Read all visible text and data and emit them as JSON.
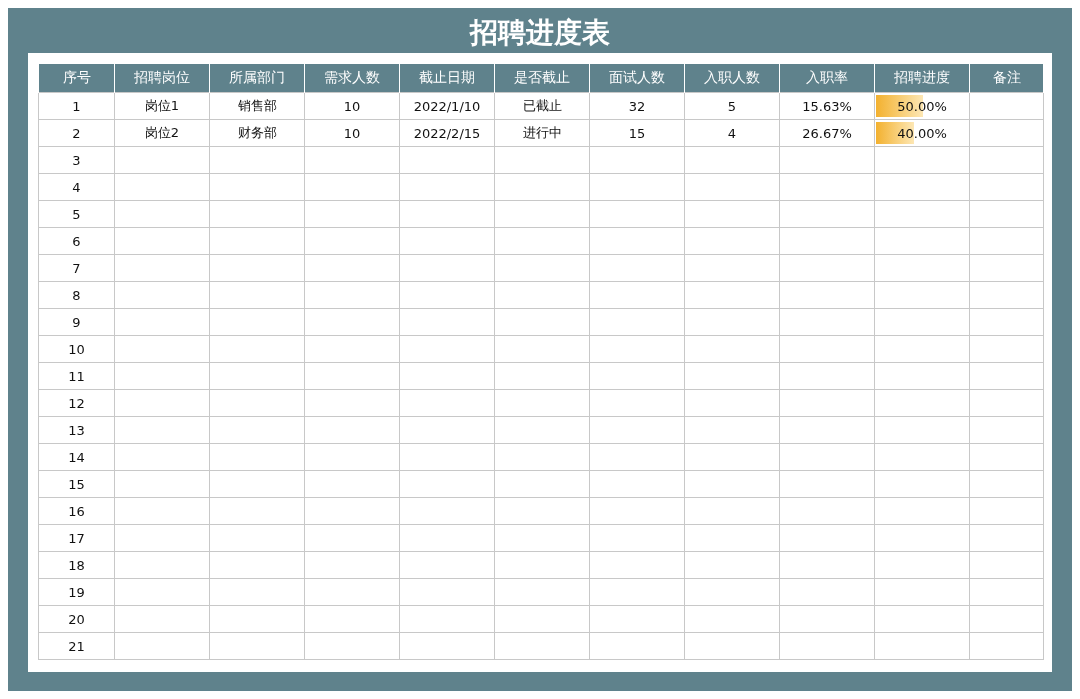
{
  "title": "招聘进度表",
  "table": {
    "columns": [
      "序号",
      "招聘岗位",
      "所属部门",
      "需求人数",
      "截止日期",
      "是否截止",
      "面试人数",
      "入职人数",
      "入职率",
      "招聘进度",
      "备注"
    ],
    "rows": [
      {
        "no": "1",
        "position": "岗位1",
        "department": "销售部",
        "demand": "10",
        "deadline": "2022/1/10",
        "status": "已截止",
        "interviews": "32",
        "hires": "5",
        "rate": "15.63%",
        "progress": {
          "text": "50.00%",
          "level": 0.5
        }
      },
      {
        "no": "2",
        "position": "岗位2",
        "department": "财务部",
        "demand": "10",
        "deadline": "2022/2/15",
        "status": "进行中",
        "interviews": "15",
        "hires": "4",
        "rate": "26.67%",
        "progress": {
          "text": "40.00%",
          "level": 0.4
        }
      },
      {
        "no": "3"
      },
      {
        "no": "4"
      },
      {
        "no": "5"
      },
      {
        "no": "6"
      },
      {
        "no": "7"
      },
      {
        "no": "8"
      },
      {
        "no": "9"
      },
      {
        "no": "10"
      },
      {
        "no": "11"
      },
      {
        "no": "12"
      },
      {
        "no": "13"
      },
      {
        "no": "14"
      },
      {
        "no": "15"
      },
      {
        "no": "16"
      },
      {
        "no": "17"
      },
      {
        "no": "18"
      },
      {
        "no": "19"
      },
      {
        "no": "20"
      },
      {
        "no": "21"
      }
    ]
  }
}
